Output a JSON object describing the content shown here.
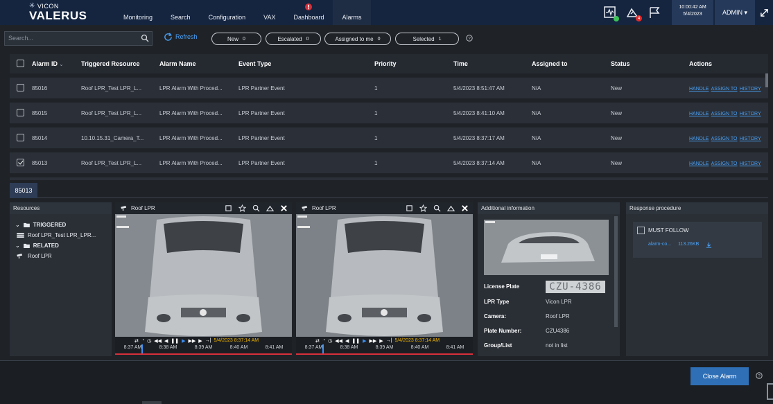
{
  "brand": {
    "company": "VICON",
    "product": "VALERUS"
  },
  "nav": [
    {
      "label": "Monitoring",
      "active": false
    },
    {
      "label": "Search",
      "active": false
    },
    {
      "label": "Configuration",
      "active": false
    },
    {
      "label": "VAX",
      "active": false
    },
    {
      "label": "Dashboard",
      "active": false,
      "alert": true
    },
    {
      "label": "Alarms",
      "active": true
    }
  ],
  "topbar": {
    "notification_count": "4",
    "time": "10:00:42 AM",
    "date": "5/4/2023",
    "user": "ADMIN"
  },
  "filters": {
    "search_placeholder": "Search...",
    "refresh_label": "Refresh",
    "pills": [
      {
        "label": "New",
        "count": "0"
      },
      {
        "label": "Escalated",
        "count": "0"
      },
      {
        "label": "Assigned to me",
        "count": "0"
      },
      {
        "label": "Selected",
        "count": "1"
      }
    ]
  },
  "table": {
    "headers": [
      "Alarm ID",
      "Triggered Resource",
      "Alarm Name",
      "Event Type",
      "Priority",
      "Time",
      "Assigned to",
      "Status",
      "Actions"
    ],
    "actions": [
      "HANDLE",
      "ASSIGN TO",
      "HISTORY"
    ],
    "rows": [
      {
        "id": "85016",
        "resource": "Roof LPR_Test LPR_L...",
        "name": "LPR Alarm With Proced...",
        "event": "LPR Partner Event",
        "priority": "1",
        "time": "5/4/2023 8:51:47 AM",
        "assigned": "N/A",
        "status": "New",
        "checked": false
      },
      {
        "id": "85015",
        "resource": "Roof LPR_Test LPR_L...",
        "name": "LPR Alarm With Proced...",
        "event": "LPR Partner Event",
        "priority": "1",
        "time": "5/4/2023 8:41:10 AM",
        "assigned": "N/A",
        "status": "New",
        "checked": false
      },
      {
        "id": "85014",
        "resource": "10.10.15.31_Camera_T...",
        "name": "LPR Alarm With Proced...",
        "event": "LPR Partner Event",
        "priority": "1",
        "time": "5/4/2023 8:37:17 AM",
        "assigned": "N/A",
        "status": "New",
        "checked": false
      },
      {
        "id": "85013",
        "resource": "Roof LPR_Test LPR_L...",
        "name": "LPR Alarm With Proced...",
        "event": "LPR Partner Event",
        "priority": "1",
        "time": "5/4/2023 8:37:14 AM",
        "assigned": "N/A",
        "status": "New",
        "checked": true
      }
    ]
  },
  "detail": {
    "tab": "85013",
    "resources": {
      "title": "Resources",
      "triggered": "TRIGGERED",
      "triggered_item": "Roof LPR_Test LPR_LPR...",
      "related": "RELATED",
      "related_item": "Roof LPR"
    },
    "cameras": [
      {
        "title": "Roof LPR",
        "timestamp": "5/4/2023 8:37:14 AM",
        "ticks": [
          "8:37 AM",
          "8:38 AM",
          "8:39 AM",
          "8:40 AM",
          "8:41 AM"
        ]
      },
      {
        "title": "Roof LPR",
        "timestamp": "5/4/2023 8:37:14 AM",
        "ticks": [
          "8:37 AM",
          "8:38 AM",
          "8:39 AM",
          "8:40 AM",
          "8:41 AM"
        ]
      }
    ],
    "additional": {
      "title": "Additional information",
      "license_plate_label": "License Plate",
      "plate_image_text": "CZU-4386",
      "fields": [
        {
          "label": "LPR Type",
          "value": "Vicon LPR"
        },
        {
          "label": "Camera:",
          "value": "Roof LPR"
        },
        {
          "label": "Plate Number:",
          "value": "CZU4386"
        },
        {
          "label": "Group/List",
          "value": "not in list"
        }
      ]
    },
    "response": {
      "title": "Response procedure",
      "must_follow": "MUST FOLLOW",
      "attachment": "alarm-co...",
      "attachment_size": "113.26KB"
    }
  },
  "footer": {
    "close_label": "Close Alarm"
  },
  "colors": {
    "topbar": "#152540",
    "accent": "#4aa0f5",
    "button": "#2f6fb6",
    "timeline": "#d92f3a"
  }
}
